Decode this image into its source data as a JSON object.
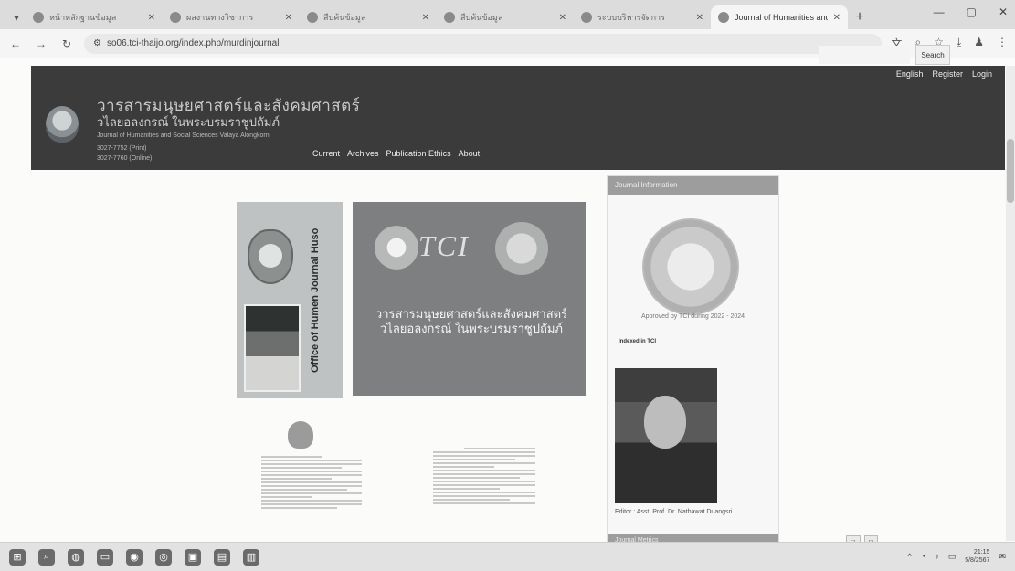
{
  "browser": {
    "tabs": [
      {
        "label": "หน้าหลักฐานข้อมูล",
        "active": false
      },
      {
        "label": "ผลงานทางวิชาการ",
        "active": false
      },
      {
        "label": "สืบค้นข้อมูล",
        "active": false
      },
      {
        "label": "สืบค้นข้อมูล",
        "active": false
      },
      {
        "label": "ระบบบริหารจัดการ",
        "active": false
      },
      {
        "label": "Journal of Humanities and",
        "active": true
      }
    ],
    "url": "so06.tci-thaijo.org/index.php/murdinjournal"
  },
  "header": {
    "title_th": "วารสารมนุษยศาสตร์และสังคมศาสตร์",
    "subtitle_th": "วไลยอลงกรณ์ ในพระบรมราชูปถัมภ์",
    "title_en": "Journal of Humanities and Social Sciences Valaya Alongkorn",
    "issn_print": "3027-7752 (Print)",
    "issn_online": "3027-7760 (Online)",
    "nav": [
      "Current",
      "Archives",
      "Publication Ethics",
      "About"
    ],
    "user_nav": [
      "English",
      "Register",
      "Login"
    ],
    "search_button": "Search"
  },
  "banner_left": {
    "vertical_text": "Office of Humen Journal Huso"
  },
  "banner_tci": {
    "logo": "TCI",
    "line1": "วารสารมนุษยศาสตร์และสังคมศาสตร์",
    "line2": "วไลยอลงกรณ์ ในพระบรมราชูปถัมภ์"
  },
  "sidebar": {
    "heading": "Journal Information",
    "approved": "Approved by TCI during 2022 - 2024",
    "indexed": "Indexed in TCI",
    "editor_caption": "Editor : Asst. Prof. Dr. Nathawat Duangsri",
    "heading2": "Journal Metrics"
  },
  "taskbar": {
    "time": "21:15",
    "date": "5/8/2567"
  }
}
